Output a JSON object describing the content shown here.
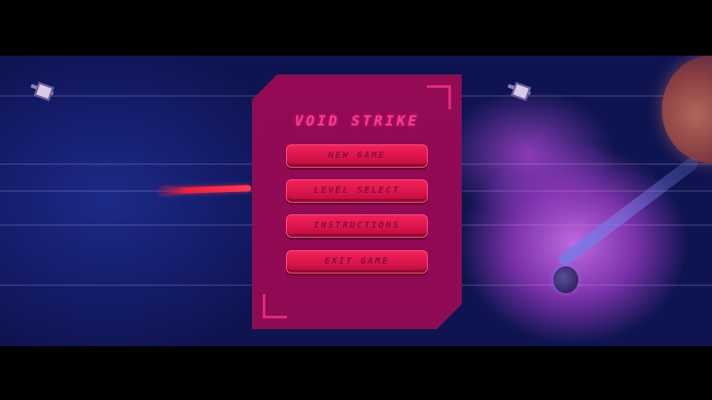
{
  "game": {
    "title": "VOID STRIKE"
  },
  "menu": {
    "items": [
      {
        "id": "new-game",
        "label": "NEW GAME"
      },
      {
        "id": "level-select",
        "label": "LEVEL SELECT"
      },
      {
        "id": "instructions",
        "label": "INSTRUCTIONS"
      },
      {
        "id": "exit-game",
        "label": "EXIT GAME"
      }
    ]
  },
  "colors": {
    "panel": "#8a0e54",
    "button": "#e01a52",
    "title": "#ff3b8e",
    "space": "#141c6a",
    "nebula": "#b04ed0"
  }
}
